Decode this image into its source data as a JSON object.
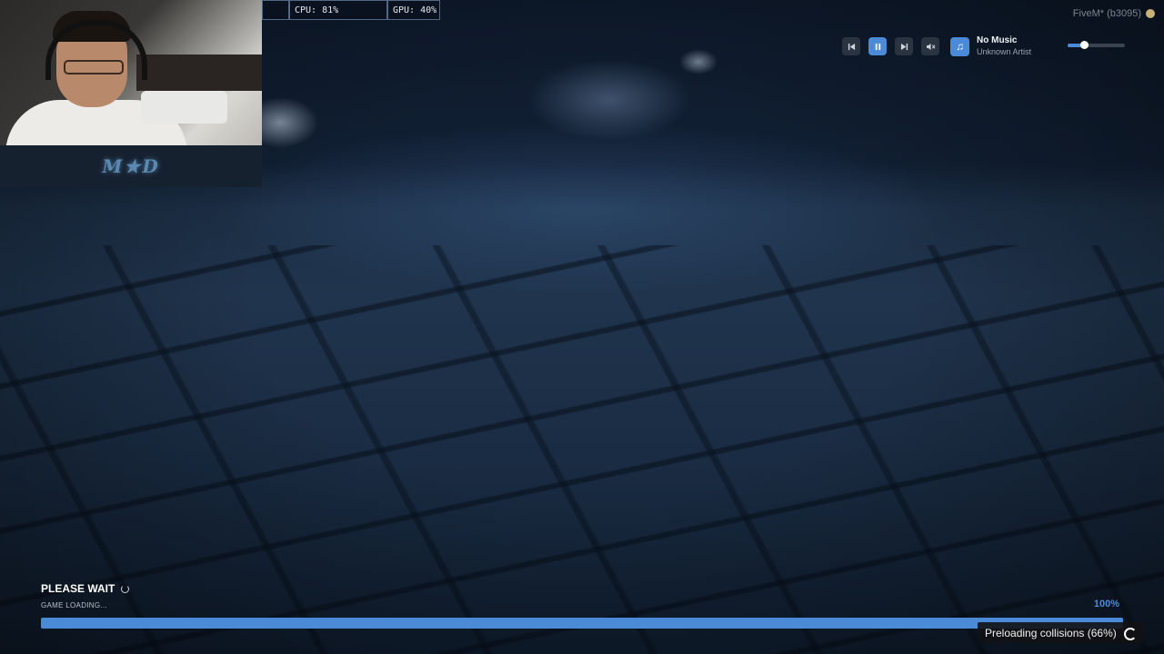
{
  "stats": {
    "cpu": "CPU: 81%",
    "gpu": "GPU: 40%"
  },
  "app": {
    "label": "FiveM* (b3095)"
  },
  "webcam": {
    "overlay_logo": "M★D"
  },
  "music": {
    "title": "No Music",
    "artist": "Unknown Artist",
    "volume_level": 0.29,
    "icons": [
      "previous-icon",
      "pause-icon",
      "next-icon",
      "mute-icon",
      "music-note-icon"
    ]
  },
  "loading": {
    "heading": "PLEASE WAIT",
    "subtitle": "GAME LOADING...",
    "percent_text": "100%",
    "progress": 1.0,
    "status": "Preloading collisions (66%)"
  },
  "colors": {
    "accent": "#4a8ad6",
    "background": "#0b1626",
    "text": "#ffffff"
  }
}
